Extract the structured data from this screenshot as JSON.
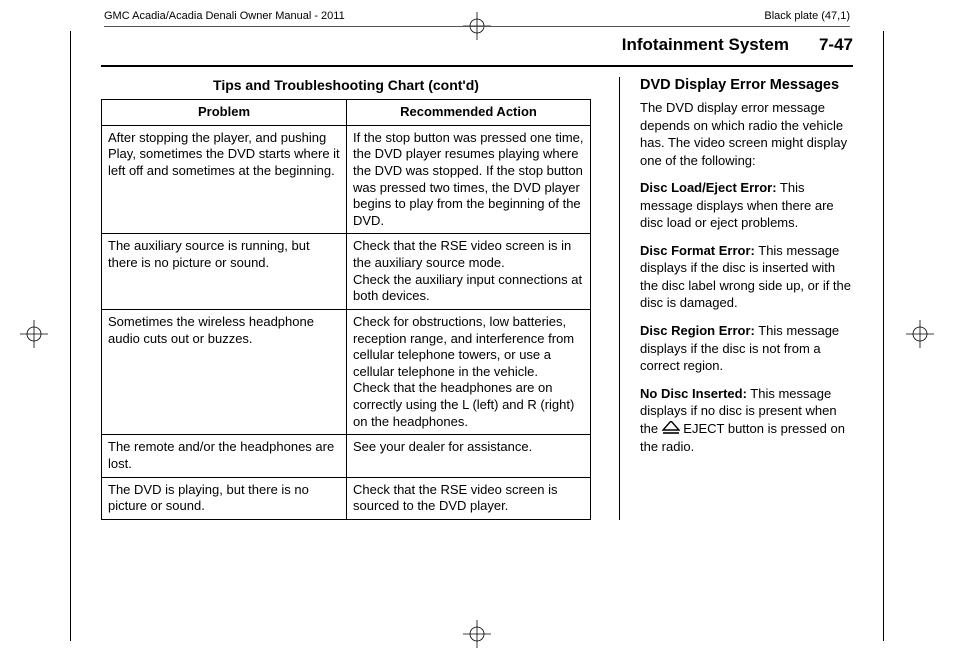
{
  "header": {
    "left": "GMC Acadia/Acadia Denali Owner Manual - 2011",
    "right": "Black plate (47,1)"
  },
  "section": {
    "title": "Infotainment System",
    "page_num": "7-47"
  },
  "chart": {
    "title": "Tips and Troubleshooting Chart (cont'd)",
    "col_problem": "Problem",
    "col_action": "Recommended Action",
    "rows": [
      {
        "problem": "After stopping the player, and pushing Play, sometimes the DVD starts where it left off and sometimes at the beginning.",
        "action": "If the stop button was pressed one time, the DVD player resumes playing where the DVD was stopped. If the stop button was pressed two times, the DVD player begins to play from the beginning of the DVD."
      },
      {
        "problem": "The auxiliary source is running, but there is no picture or sound.",
        "action": "Check that the RSE video screen is in the auxiliary source mode.\nCheck the auxiliary input connections at both devices."
      },
      {
        "problem": "Sometimes the wireless headphone audio cuts out or buzzes.",
        "action": "Check for obstructions, low batteries, reception range, and interference from cellular telephone towers, or use a cellular telephone in the vehicle.\nCheck that the headphones are on correctly using the L (left) and R (right) on the headphones."
      },
      {
        "problem": "The remote and/or the headphones are lost.",
        "action": "See your dealer for assistance."
      },
      {
        "problem": "The DVD is playing, but there is no picture or sound.",
        "action": "Check that the RSE video screen is sourced to the DVD player."
      }
    ]
  },
  "right": {
    "heading": "DVD Display Error Messages",
    "intro": "The DVD display error message depends on which radio the vehicle has. The video screen might display one of the following:",
    "items": [
      {
        "label": "Disc Load/Eject Error:",
        "text": "  This message displays when there are disc load or eject problems."
      },
      {
        "label": "Disc Format Error:",
        "text": "  This message displays if the disc is inserted with the disc label wrong side up, or if the disc is damaged."
      },
      {
        "label": "Disc Region Error:",
        "text": "  This message displays if the disc is not from a correct region."
      },
      {
        "label": "No Disc Inserted:",
        "text_pre": "  This message displays if no disc is present when the ",
        "text_post": " EJECT button is pressed on the radio."
      }
    ]
  }
}
